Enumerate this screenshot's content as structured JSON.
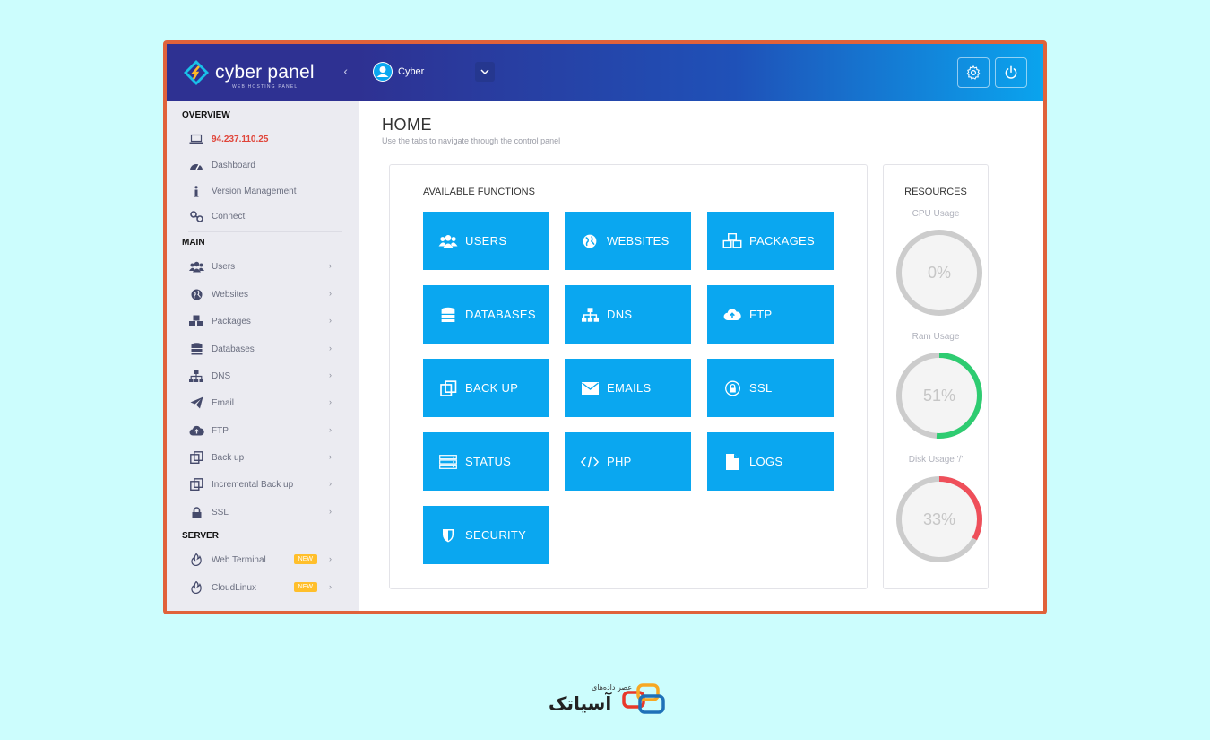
{
  "brand": {
    "name": "cyber panel",
    "tagline": "WEB HOSTING PANEL"
  },
  "header": {
    "username": "Cyber"
  },
  "sidebar": {
    "sections": [
      "OVERVIEW",
      "MAIN",
      "SERVER"
    ],
    "overview": [
      {
        "label": "94.237.110.25",
        "icon": "laptop-icon"
      },
      {
        "label": "Dashboard",
        "icon": "dashboard-icon"
      },
      {
        "label": "Version Management",
        "icon": "info-icon"
      },
      {
        "label": "Connect",
        "icon": "link-icon"
      }
    ],
    "main": [
      {
        "label": "Users",
        "icon": "users-icon"
      },
      {
        "label": "Websites",
        "icon": "globe-icon"
      },
      {
        "label": "Packages",
        "icon": "cubes-icon"
      },
      {
        "label": "Databases",
        "icon": "database-icon"
      },
      {
        "label": "DNS",
        "icon": "sitemap-icon"
      },
      {
        "label": "Email",
        "icon": "paper-plane-icon"
      },
      {
        "label": "FTP",
        "icon": "cloud-upload-icon"
      },
      {
        "label": "Back up",
        "icon": "copy-icon"
      },
      {
        "label": "Incremental Back up",
        "icon": "copy-icon"
      },
      {
        "label": "SSL",
        "icon": "lock-icon"
      }
    ],
    "server": [
      {
        "label": "Web Terminal",
        "icon": "fire-icon",
        "badge": "NEW"
      },
      {
        "label": "CloudLinux",
        "icon": "fire-icon",
        "badge": "NEW"
      }
    ]
  },
  "main": {
    "title": "HOME",
    "subtitle": "Use the tabs to navigate through the control panel",
    "functions_title": "AVAILABLE FUNCTIONS",
    "tiles": [
      {
        "label": "USERS",
        "icon": "users-icon"
      },
      {
        "label": "WEBSITES",
        "icon": "globe-icon"
      },
      {
        "label": "PACKAGES",
        "icon": "cubes-icon"
      },
      {
        "label": "DATABASES",
        "icon": "database-icon"
      },
      {
        "label": "DNS",
        "icon": "sitemap-icon"
      },
      {
        "label": "FTP",
        "icon": "cloud-upload-icon"
      },
      {
        "label": "BACK UP",
        "icon": "copy-icon"
      },
      {
        "label": "EMAILS",
        "icon": "envelope-icon"
      },
      {
        "label": "SSL",
        "icon": "lock-icon"
      },
      {
        "label": "STATUS",
        "icon": "server-icon"
      },
      {
        "label": "PHP",
        "icon": "code-icon"
      },
      {
        "label": "LOGS",
        "icon": "file-icon"
      },
      {
        "label": "SECURITY",
        "icon": "shield-icon"
      }
    ]
  },
  "resources": {
    "title": "RESOURCES",
    "gauges": [
      {
        "label": "CPU Usage",
        "value": 0,
        "text": "0%",
        "color": "#cccccc"
      },
      {
        "label": "Ram Usage",
        "value": 51,
        "text": "51%",
        "color": "#2ecc71"
      },
      {
        "label": "Disk Usage '/'",
        "value": 33,
        "text": "33%",
        "color": "#ef4f5a"
      }
    ]
  },
  "footer": {
    "small_text": "عصر داده‌های",
    "big_text": "آسیاتک"
  },
  "colors": {
    "accent": "#0aa7f0",
    "header": "#2e3192",
    "frame": "#e0623a"
  }
}
